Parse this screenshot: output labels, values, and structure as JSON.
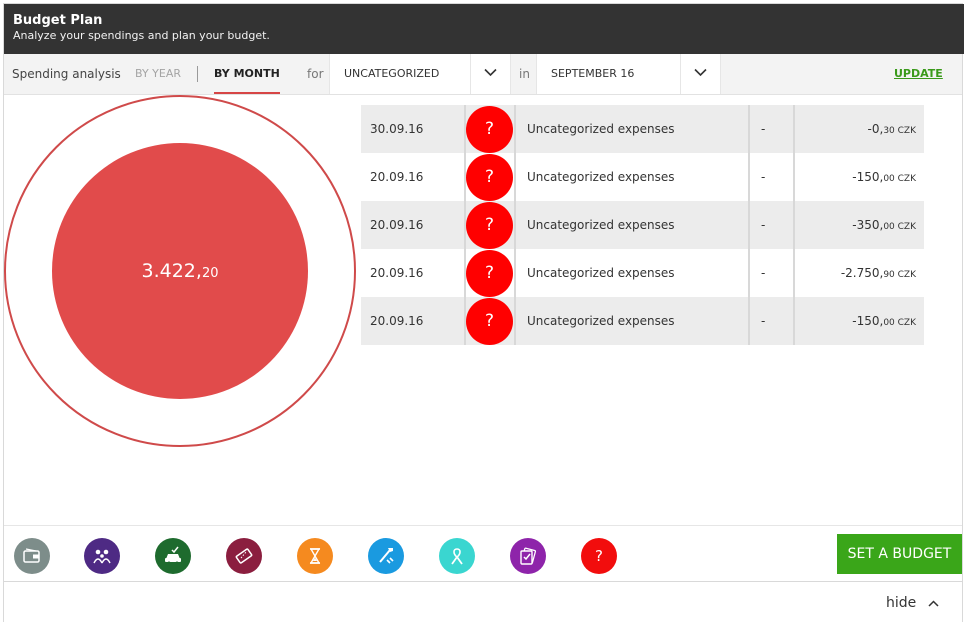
{
  "header": {
    "title": "Budget Plan",
    "subtitle": "Analyze your spendings and plan your budget."
  },
  "toolbar": {
    "spending_label": "Spending analysis",
    "by_year_label": "BY YEAR",
    "by_month_label": "BY MONTH",
    "active_period": "BY MONTH",
    "for_label": "for",
    "category_value": "UNCATEGORIZED",
    "in_label": "in",
    "month_value": "SEPTEMBER 16",
    "update_label": "UPDATE"
  },
  "summary": {
    "total_integer": "3.422,",
    "total_decimal": "20"
  },
  "transactions": [
    {
      "date": "30.09.16",
      "category_glyph": "?",
      "description": "Uncategorized expenses",
      "note": "-",
      "amount_integer": "-0,",
      "amount_decimal": "30 CZK"
    },
    {
      "date": "20.09.16",
      "category_glyph": "?",
      "description": "Uncategorized expenses",
      "note": "-",
      "amount_integer": "-150,",
      "amount_decimal": "00 CZK"
    },
    {
      "date": "20.09.16",
      "category_glyph": "?",
      "description": "Uncategorized expenses",
      "note": "-",
      "amount_integer": "-350,",
      "amount_decimal": "00 CZK"
    },
    {
      "date": "20.09.16",
      "category_glyph": "?",
      "description": "Uncategorized expenses",
      "note": "-",
      "amount_integer": "-2.750,",
      "amount_decimal": "90 CZK"
    },
    {
      "date": "20.09.16",
      "category_glyph": "?",
      "description": "Uncategorized expenses",
      "note": "-",
      "amount_integer": "-150,",
      "amount_decimal": "00 CZK"
    }
  ],
  "categories": [
    {
      "icon": "wallet-icon",
      "color": "#7d8d8a"
    },
    {
      "icon": "family-icon",
      "color": "#4e2a84"
    },
    {
      "icon": "car-icon",
      "color": "#1e6b2e"
    },
    {
      "icon": "ticket-icon",
      "color": "#8b1e3f"
    },
    {
      "icon": "hourglass-icon",
      "color": "#f58a1f"
    },
    {
      "icon": "tools-icon",
      "color": "#1a9ae0"
    },
    {
      "icon": "ribbon-icon",
      "color": "#3ad6d0"
    },
    {
      "icon": "documents-icon",
      "color": "#8e24aa"
    },
    {
      "icon": "question-icon",
      "color": "#f20d0d",
      "glyph": "?"
    }
  ],
  "actions": {
    "set_budget_label": "SET A BUDGET",
    "hide_label": "hide"
  },
  "colors": {
    "header_bg": "#333333",
    "accent_red": "#e14b4b",
    "uncategorized_red": "#ff0000",
    "primary_green": "#3aa619"
  }
}
